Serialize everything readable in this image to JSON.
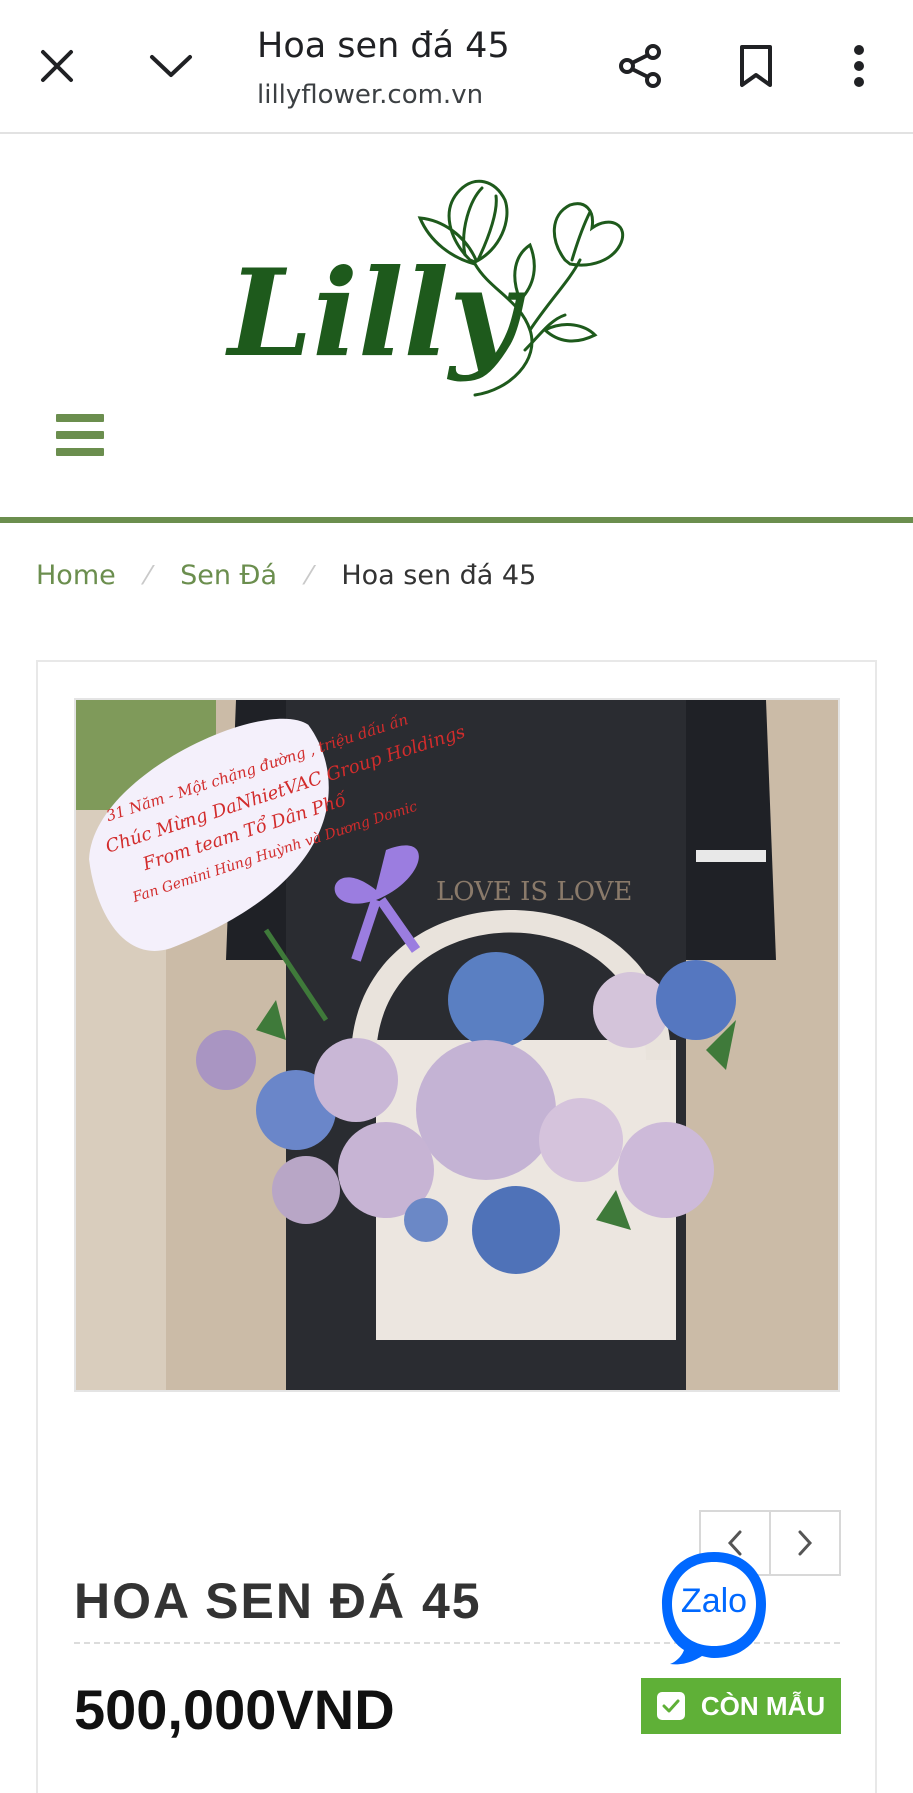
{
  "browser": {
    "page_title": "Hoa sen đá 45",
    "url": "lillyflower.com.vn",
    "icons": [
      "close-icon",
      "chevron-down-icon",
      "share-icon",
      "bookmark-icon",
      "more-vert-icon"
    ]
  },
  "site": {
    "brand_logo_text": "Lilly",
    "accent_color": "#6b8e4e",
    "logo_color": "#1e5a1c",
    "menu_icon": "hamburger-icon"
  },
  "breadcrumb": {
    "items": [
      "Home",
      "Sen Đá"
    ],
    "current": "Hoa sen đá 45"
  },
  "product": {
    "title": "HOA SEN ĐÁ 45",
    "price": "500,000VND",
    "stock_label": "CÒN MẪU",
    "stock_color": "#5fb037",
    "image_sign_lines": [
      "31 Năm - Một chặng đường , triệu dấu ấn",
      "Chúc Mừng DaNhietVAC Group Holdings",
      "From team Tổ Dân Phố",
      "Fan Gemini Hùng Huỳnh và Dương Domic"
    ],
    "image_arch_text": "LOVE IS LOVE"
  },
  "floating": {
    "zalo_label": "Zalo"
  }
}
